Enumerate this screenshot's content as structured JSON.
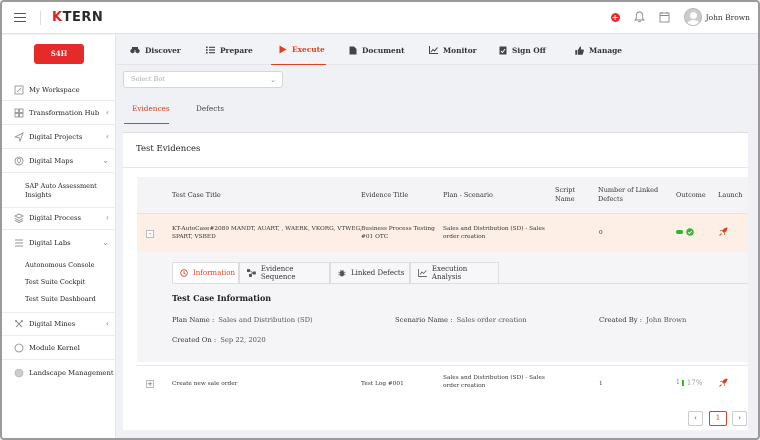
{
  "header": {
    "logo_k": "K",
    "logo_rest": "TERN",
    "plus_symbol": "+",
    "user_name": "John Brown"
  },
  "sidebar": {
    "badge": "S4H",
    "items": [
      {
        "label": "My Workspace",
        "icon": "workspace-icon"
      },
      {
        "label": "Transformation Hub",
        "icon": "grid-icon",
        "chevron": "‹"
      },
      {
        "label": "Digital Projects",
        "icon": "send-icon",
        "chevron": "‹"
      },
      {
        "label": "Digital Maps",
        "icon": "map-icon",
        "chevron": "⌄"
      },
      {
        "label": "Digital Process",
        "icon": "process-icon",
        "chevron": "‹"
      },
      {
        "label": "Digital Labs",
        "icon": "list-icon",
        "chevron": "⌄"
      },
      {
        "label": "Digital Mines",
        "icon": "tools-icon",
        "chevron": "‹"
      },
      {
        "label": "Module Kernel",
        "icon": "kernel-icon"
      },
      {
        "label": "Landscape Management",
        "icon": "globe-icon"
      }
    ],
    "maps_sub": [
      "SAP Auto Assessment",
      "Insights"
    ],
    "labs_sub": [
      "Autonomous Console",
      "Test Suite Cockpit",
      "Test Suite Dashboard"
    ]
  },
  "tabs": [
    {
      "label": "Discover",
      "icon": "binoculars-icon"
    },
    {
      "label": "Prepare",
      "icon": "list-check-icon"
    },
    {
      "label": "Execute",
      "icon": "play-icon",
      "active": true
    },
    {
      "label": "Document",
      "icon": "document-icon"
    },
    {
      "label": "Monitor",
      "icon": "chart-icon"
    },
    {
      "label": "Sign Off",
      "icon": "signoff-icon"
    },
    {
      "label": "Manage",
      "icon": "thumbs-up-icon"
    }
  ],
  "select_bot": {
    "placeholder": "Select Bot",
    "caret": "⌄"
  },
  "subtabs": {
    "evidences": "Evidences",
    "defects": "Defects"
  },
  "card": {
    "title": "Test Evidences",
    "columns": {
      "test_case_title": "Test Case Title",
      "evidence_title": "Evidence Title",
      "plan_scenario": "Plan - Scenario",
      "script_name_1": "Script",
      "script_name_2": "Name",
      "linked_defects_1": "Number of Linked",
      "linked_defects_2": "Defects",
      "outcome": "Outcome",
      "launch": "Launch"
    },
    "row1": {
      "toggle": "-",
      "title_line1": "KT-AutoCase#2089 MANDT, AUART, , WAERK, VKORG, VTWEG,",
      "title_line2": "SPART, VSBED",
      "evidence_line1": "Business Process Testing",
      "evidence_line2": "#01 OTC",
      "scenario_line1": "Sales and Distribution (SD) - Sales",
      "scenario_line2": "order creation",
      "linked_defects": "0"
    },
    "detail_tabs": {
      "information": "Information",
      "evidence_sequence": "Evidence Sequence",
      "linked_defects": "Linked Defects",
      "execution_analysis": "Execution Analysis"
    },
    "info": {
      "heading": "Test Case Information",
      "plan_name_label": "Plan Name :",
      "plan_name_value": "Sales and Distribution (SD)",
      "scenario_name_label": "Scenario Name :",
      "scenario_name_value": "Sales order creation",
      "created_by_label": "Created By :",
      "created_by_value": "John Brown",
      "created_on_label": "Created On :",
      "created_on_value": "Sep 22, 2020"
    },
    "row2": {
      "toggle": "+",
      "title": "Create new sale order",
      "evidence": "Test Log #001",
      "scenario_line1": "Sales and Distribution (SD) - Sales",
      "scenario_line2": "order creation",
      "linked_defects": "1",
      "outcome_value": "1",
      "outcome_percent": "17%",
      "progress": 0.17
    },
    "pagination": {
      "prev": "‹",
      "current": "1",
      "next": "›"
    }
  },
  "colors": {
    "accent": "#e04020",
    "success": "#2eb82e",
    "danger": "#e52a2a"
  }
}
